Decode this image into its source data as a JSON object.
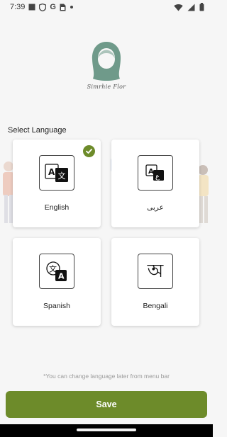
{
  "status_bar": {
    "time": "7:39",
    "left_icons": [
      "square-notification-icon",
      "shield-icon",
      "google-icon",
      "sim-card-icon",
      "dot-icon"
    ],
    "right_icons": [
      "wifi-icon",
      "signal-icon",
      "battery-icon"
    ]
  },
  "logo": {
    "text": "Simrhie Flor"
  },
  "select_language_label": "Select Language",
  "languages": [
    {
      "label": "English",
      "glyph_a": "A",
      "glyph_b": "文",
      "selected": true
    },
    {
      "label": "عربى",
      "glyph_a": "A",
      "glyph_b": "ع",
      "selected": false
    },
    {
      "label": "Spanish",
      "glyph_a": "文",
      "glyph_b": "A",
      "selected": false
    },
    {
      "label": "Bengali",
      "glyph_a": "অ",
      "glyph_b": "",
      "selected": false
    }
  ],
  "hint": "*You can change language later from menu bar",
  "save_label": "Save",
  "colors": {
    "accent": "#6d8b2a",
    "logo": "#6f9a8a",
    "background": "#f6f6f6"
  }
}
